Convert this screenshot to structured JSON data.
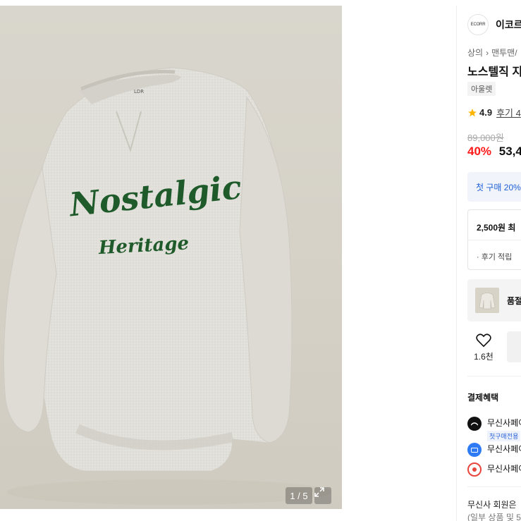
{
  "gallery": {
    "counter": "1 / 5",
    "garment_text_1": "Nostalgic",
    "garment_text_2": "Heritage",
    "garment_label": "LDR"
  },
  "brand": {
    "logo_text": "ECORR",
    "name": "이코르"
  },
  "breadcrumb": [
    "상의",
    "맨투맨/"
  ],
  "product": {
    "title": "노스텔직 지",
    "outlet_tag": "아울렛",
    "rating": "4.9",
    "reviews": "후기 4",
    "original_price": "89,000원",
    "discount": "40%",
    "sale_price": "53,4"
  },
  "coupon": {
    "text": "첫 구매 20%"
  },
  "points": {
    "title": "2,500원 최",
    "sub": "· 후기 적립"
  },
  "restock": {
    "label": "품절"
  },
  "actions": {
    "like_count": "1.6천"
  },
  "benefits": {
    "title": "결제혜택",
    "items": [
      {
        "label": "무신사페이",
        "sub": "첫구매전용",
        "icon": "musinsa-pay-icon",
        "color": "#111111"
      },
      {
        "label": "무신사페이",
        "icon": "card-blue-icon",
        "color": "#2f7bf5"
      },
      {
        "label": "무신사페이",
        "icon": "card-red-icon",
        "color": "#e8453c"
      }
    ]
  },
  "member": {
    "note": "무신사 회원은",
    "note2": "(일부 상품 및 5"
  },
  "colors": {
    "discount": "#ff1a1a",
    "star": "#ffb400",
    "coupon_text": "#1d5fd6",
    "embroidery": "#1f5a2b"
  }
}
